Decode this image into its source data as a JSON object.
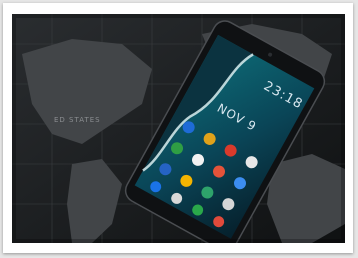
{
  "photo": {
    "map_label": "ED STATES",
    "phone": {
      "time": "23:18",
      "date": "NOV 9"
    }
  },
  "colors": {
    "background": "#1b1d1f",
    "phone_body": "#111315",
    "screen_ocean": "#0f5a6e",
    "land": "#3f4244"
  }
}
